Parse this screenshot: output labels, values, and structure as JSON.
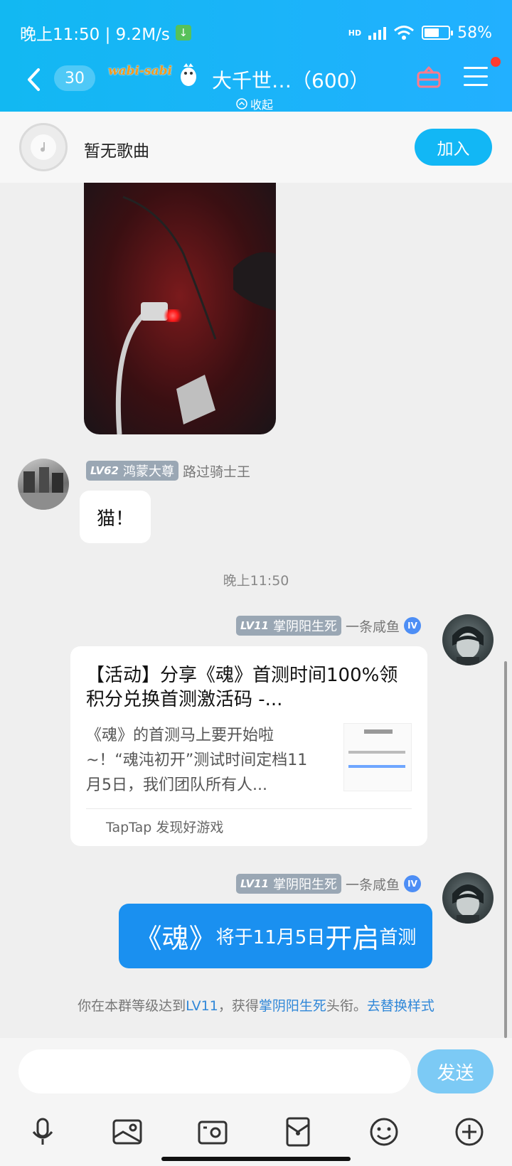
{
  "status_bar": {
    "time_speed": "晚上11:50 | 9.2M/s",
    "network": "HD",
    "battery": "58%"
  },
  "nav": {
    "unread_count": "30",
    "logo_text": "wabi-sabi",
    "group_title": "大千世…（600）",
    "collapse_label": "收起"
  },
  "music_bar": {
    "status": "暂无歌曲",
    "join_label": "加入"
  },
  "messages": [
    {
      "type": "image",
      "side": "left"
    },
    {
      "type": "text",
      "side": "left",
      "level": "LV62",
      "rank_title": "鸿蒙大尊",
      "nickname": "路过骑士王",
      "text": "猫！"
    },
    {
      "type": "time",
      "text": "晚上11:50"
    },
    {
      "type": "share_card",
      "side": "right",
      "level": "LV11",
      "rank_title": "掌阴阳生死",
      "nickname": "一条咸鱼",
      "vip_badge": "IV",
      "card_title": "【活动】分享《魂》首测时间100%领积分兑换首测激活码 -...",
      "card_desc": "《魂》的首测马上要开始啦~！“魂沌初开”测试时间定档11月5日，我们团队所有人...",
      "card_source": "TapTap 发现好游戏"
    },
    {
      "type": "text",
      "side": "right",
      "level": "LV11",
      "rank_title": "掌阴阳生死",
      "nickname": "一条咸鱼",
      "vip_badge": "IV",
      "text_parts": [
        "《魂》",
        "将于11月5日",
        "开启",
        "首测"
      ]
    }
  ],
  "notice": {
    "prefix": "你在本群等级达到",
    "level": "LV11",
    "middle": "，获得",
    "title": "掌阴阳生死",
    "suffix": "头衔。",
    "link": "去替换样式"
  },
  "input": {
    "placeholder": "",
    "send_label": "发送"
  },
  "toolbar_icons": [
    "microphone-icon",
    "image-icon",
    "camera-icon",
    "red-packet-icon",
    "emoji-icon",
    "plus-icon"
  ],
  "colors": {
    "header": "#12b8f2",
    "join_button": "#12b7f5",
    "bubble_blue": "#1a90f0",
    "send_button": "#7ccaf5",
    "link": "#2f87d8"
  }
}
